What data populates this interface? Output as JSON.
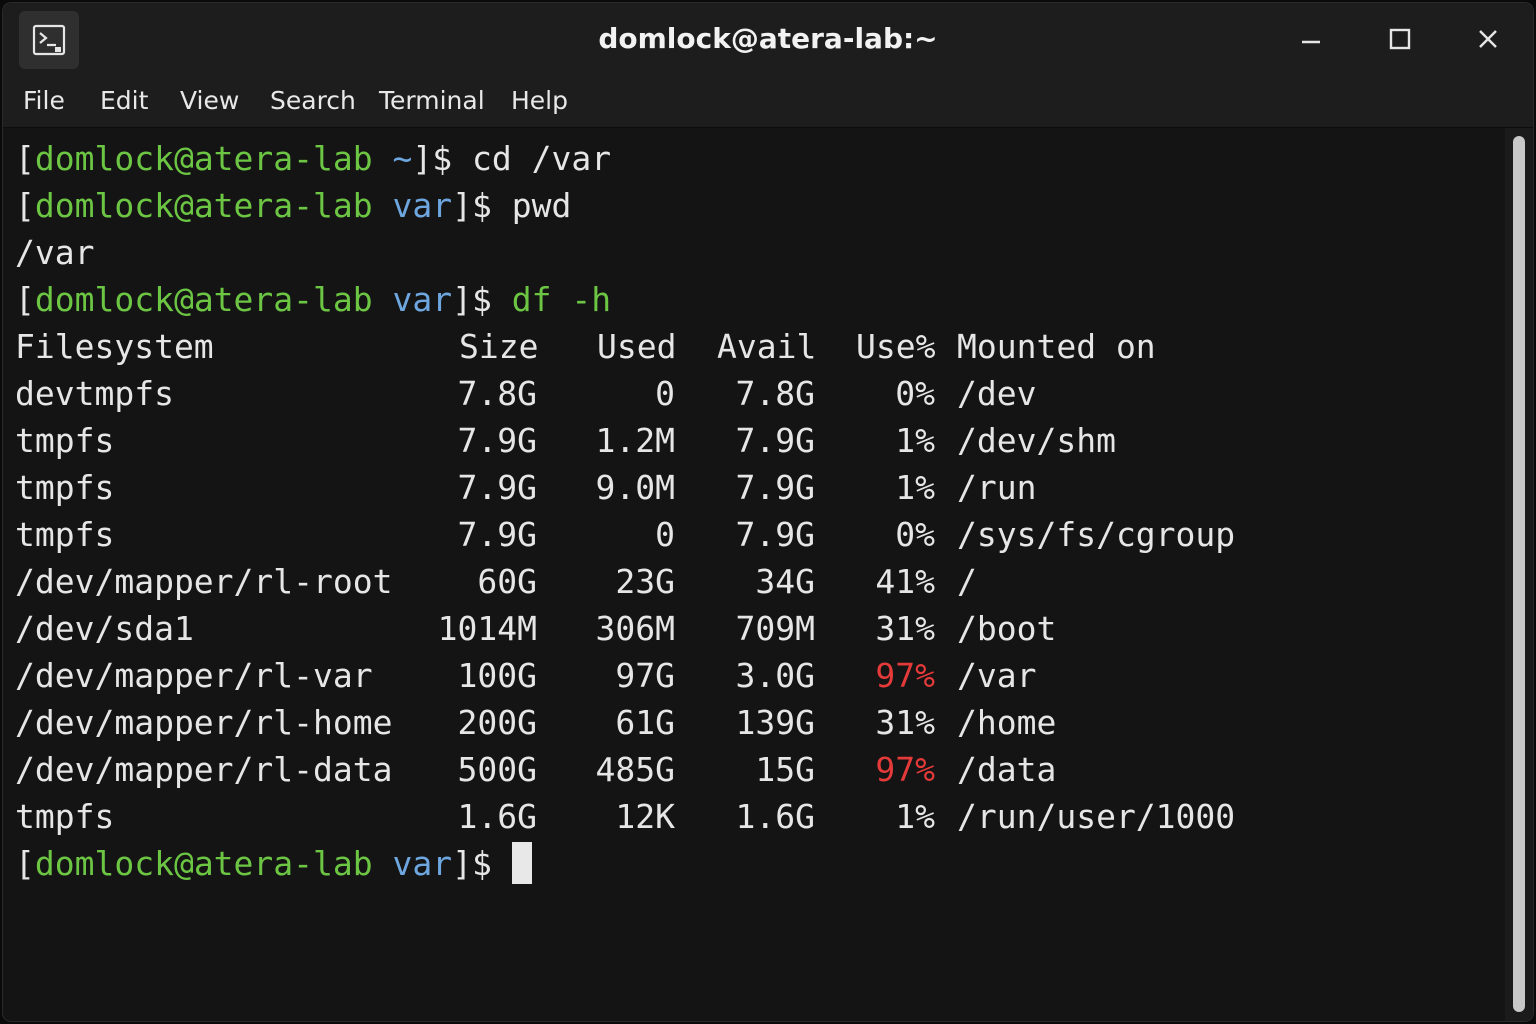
{
  "window": {
    "title": "domlock@atera-lab:~"
  },
  "icons": {
    "app": "terminal-icon",
    "minimize": "minimize-icon",
    "maximize": "maximize-icon",
    "close": "close-icon"
  },
  "menu": [
    "File",
    "Edit",
    "View",
    "Search",
    "Terminal",
    "Help"
  ],
  "prompt": {
    "user_host": "domlock@atera-lab",
    "dir_home": "~",
    "dir_var": "var",
    "open_bracket": "[",
    "close_symbol": "]$"
  },
  "commands": {
    "cmd1": "cd /var",
    "cmd2": "pwd",
    "pwd_output": "/var",
    "cmd3": "df -h"
  },
  "df": {
    "headers": {
      "filesystem": "Filesystem",
      "size": "Size",
      "used": "Used",
      "avail": "Avail",
      "usep": "Use%",
      "mounted": "Mounted on"
    },
    "rows": [
      {
        "filesystem": "devtmpfs",
        "size": "7.8G",
        "used": "0",
        "avail": "7.8G",
        "usep": "0%",
        "mounted": "/dev"
      },
      {
        "filesystem": "tmpfs",
        "size": "7.9G",
        "used": "1.2M",
        "avail": "7.9G",
        "usep": "1%",
        "mounted": "/dev/shm"
      },
      {
        "filesystem": "tmpfs",
        "size": "7.9G",
        "used": "9.0M",
        "avail": "7.9G",
        "usep": "1%",
        "mounted": "/run"
      },
      {
        "filesystem": "tmpfs",
        "size": "7.9G",
        "used": "0",
        "avail": "7.9G",
        "usep": "0%",
        "mounted": "/sys/fs/cgroup"
      },
      {
        "filesystem": "/dev/mapper/rl-root",
        "size": "60G",
        "used": "23G",
        "avail": "34G",
        "usep": "41%",
        "mounted": "/"
      },
      {
        "filesystem": "/dev/sda1",
        "size": "1014M",
        "used": "306M",
        "avail": "709M",
        "usep": "31%",
        "mounted": "/boot"
      },
      {
        "filesystem": "/dev/mapper/rl-var",
        "size": "100G",
        "used": "97G",
        "avail": "3.0G",
        "usep": "97%",
        "mounted": "/var"
      },
      {
        "filesystem": "/dev/mapper/rl-home",
        "size": "200G",
        "used": "61G",
        "avail": "139G",
        "usep": "31%",
        "mounted": "/home"
      },
      {
        "filesystem": "/dev/mapper/rl-data",
        "size": "500G",
        "used": "485G",
        "avail": "15G",
        "usep": "97%",
        "mounted": "/data"
      },
      {
        "filesystem": "tmpfs",
        "size": "1.6G",
        "used": "12K",
        "avail": "1.6G",
        "usep": "1%",
        "mounted": "/run/user/1000"
      }
    ]
  },
  "colors": {
    "prompt_user": "#6cc644",
    "prompt_dir": "#6ea7e0",
    "warning": "#e53a3a",
    "text": "#e6e6e6",
    "background": "#141414"
  }
}
